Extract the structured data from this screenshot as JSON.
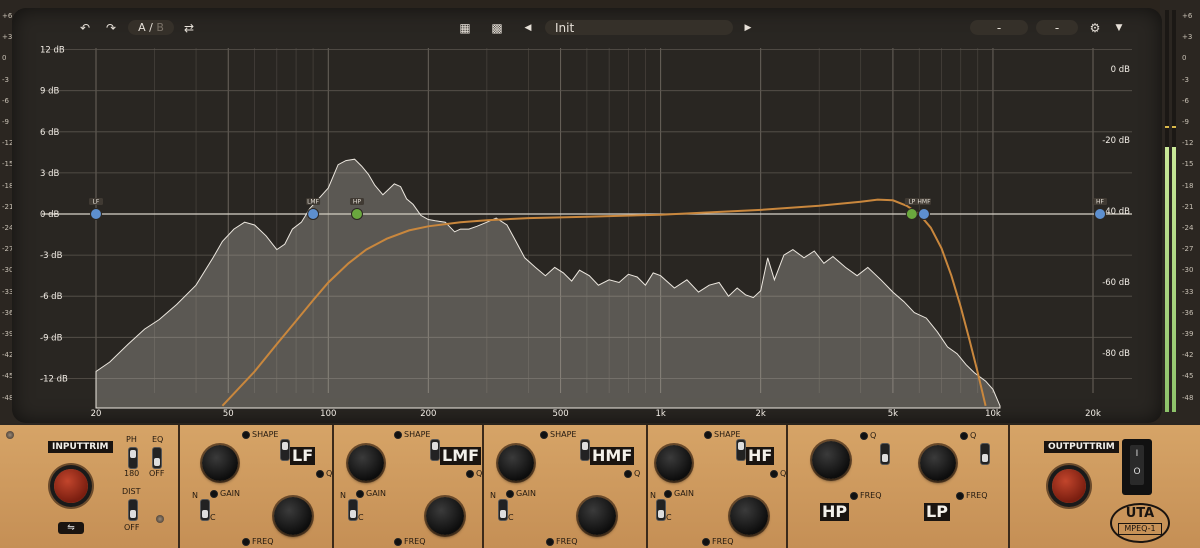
{
  "toolbar": {
    "ab_label": "A",
    "ab_sep": "/",
    "ab_alt": "B",
    "preset_name": "Init",
    "field1": "-",
    "field2": "-"
  },
  "graph": {
    "gain_labels_left": [
      "12 dB",
      "9 dB",
      "6 dB",
      "3 dB",
      "0 dB",
      "-3 dB",
      "-6 dB",
      "-9 dB",
      "-12 dB"
    ],
    "spectrum_labels_right": [
      "0 dB",
      "-20 dB",
      "-40 dB",
      "-60 dB",
      "-80 dB"
    ],
    "freq_labels": [
      "20",
      "50",
      "100",
      "200",
      "500",
      "1k",
      "2k",
      "5k",
      "10k",
      "20k"
    ],
    "nodes": [
      {
        "label": "LF",
        "color": "#5d8fcf"
      },
      {
        "label": "LMF",
        "color": "#5d8fcf"
      },
      {
        "label": "HP",
        "color": "#6aa83e"
      },
      {
        "label": "LP",
        "color": "#6aa83e"
      },
      {
        "label": "HMF",
        "color": "#5d8fcf"
      },
      {
        "label": "HF",
        "color": "#5d8fcf"
      }
    ],
    "curve_color": "#c9873d"
  },
  "meters": {
    "left_scale": [
      "+6",
      "+3",
      "0",
      "-3",
      "-6",
      "-9",
      "-12",
      "-15",
      "-18",
      "-21",
      "-24",
      "-27",
      "-30",
      "-33",
      "-36",
      "-39",
      "-42",
      "-45",
      "-48"
    ],
    "right_scale": [
      "+6",
      "+3",
      "0",
      "-3",
      "-6",
      "-9",
      "-12",
      "-15",
      "-18",
      "-21",
      "-24",
      "-27",
      "-30",
      "-33",
      "-36",
      "-39",
      "-42",
      "-45",
      "-48"
    ],
    "fill_color": "#a8d47e"
  },
  "panel": {
    "input_trim": "INPUTTRIM",
    "output_trim": "OUTPUTTRIM",
    "ph_label": "PH",
    "ph_value": "180",
    "eq_label": "EQ",
    "eq_value": "OFF",
    "dist_label": "DIST",
    "dist_value": "OFF",
    "power_on": "I",
    "power_off": "O",
    "brand": "UTA",
    "model": "MPEQ-1",
    "bands": [
      {
        "name": "LF",
        "shape": "SHAPE",
        "gain": "GAIN",
        "freq": "FREQ",
        "q": "Q",
        "n": "N",
        "c": "C"
      },
      {
        "name": "LMF",
        "shape": "SHAPE",
        "gain": "GAIN",
        "freq": "FREQ",
        "q": "Q",
        "n": "N",
        "c": "C"
      },
      {
        "name": "HMF",
        "shape": "SHAPE",
        "gain": "GAIN",
        "freq": "FREQ",
        "q": "Q",
        "n": "N",
        "c": "C"
      },
      {
        "name": "HF",
        "shape": "SHAPE",
        "gain": "GAIN",
        "freq": "FREQ",
        "q": "Q",
        "n": "N",
        "c": "C"
      }
    ],
    "filters": [
      {
        "name": "HP",
        "q": "Q",
        "freq": "FREQ"
      },
      {
        "name": "LP",
        "q": "Q",
        "freq": "FREQ"
      }
    ]
  }
}
